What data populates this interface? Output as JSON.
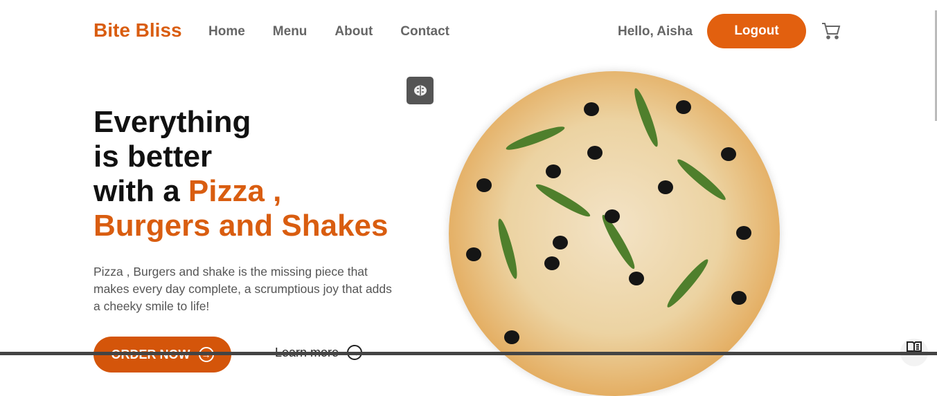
{
  "nav": {
    "logo": "Bite Bliss",
    "links": [
      "Home",
      "Menu",
      "About",
      "Contact"
    ],
    "greeting": "Hello, Aisha",
    "logout": "Logout"
  },
  "hero": {
    "line1": "Everything",
    "line2": "is better",
    "line3_prefix": "with a ",
    "line3_accent": "Pizza ,",
    "line4": "Burgers and Shakes",
    "description": "Pizza , Burgers and shake is the missing piece that makes every day complete, a scrumptious joy that adds a cheeky smile to life!",
    "order_button": "ORDER NOW",
    "learn_more": "Learn more"
  },
  "colors": {
    "accent": "#d95d10"
  }
}
